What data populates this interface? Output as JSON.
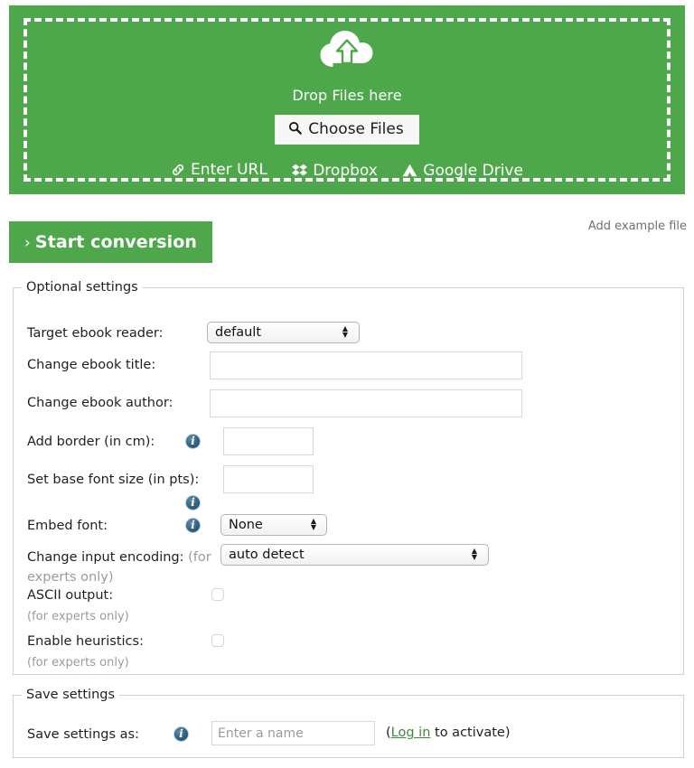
{
  "dropzone": {
    "icon": "cloud-upload-icon",
    "drop_label": "Drop Files here",
    "choose_files_label": "Choose Files",
    "choose_files_icon": "search-icon",
    "sources": [
      {
        "label": "Enter URL",
        "icon": "link-icon"
      },
      {
        "label": "Dropbox",
        "icon": "dropbox-icon"
      },
      {
        "label": "Google Drive",
        "icon": "google-drive-icon"
      }
    ],
    "bg_color": "#4ea74b",
    "border_color": "#ffffff"
  },
  "actions": {
    "start_conversion_label": "Start conversion",
    "start_conversion_chevron": "›",
    "add_example_file_label": "Add example file"
  },
  "optional_settings": {
    "legend": "Optional settings",
    "rows": {
      "target_reader": {
        "label": "Target ebook reader:",
        "value": "default",
        "options": [
          "default"
        ]
      },
      "ebook_title": {
        "label": "Change ebook title:",
        "value": "",
        "placeholder": ""
      },
      "ebook_author": {
        "label": "Change ebook author:",
        "value": "",
        "placeholder": ""
      },
      "border": {
        "label": "Add border (in cm):",
        "value": "",
        "placeholder": "",
        "info_icon": "info-icon"
      },
      "base_font_size": {
        "label": "Set base font size (in pts):",
        "value": "",
        "placeholder": "",
        "info_icon": "info-icon"
      },
      "embed_font": {
        "label": "Embed font:",
        "value": "None",
        "options": [
          "None"
        ],
        "info_icon": "info-icon"
      },
      "input_encoding": {
        "label": "Change input encoding:",
        "label_muted": "(for experts only)",
        "value": "auto detect",
        "options": [
          "auto detect"
        ]
      },
      "ascii_output": {
        "label": "ASCII output:",
        "sub": "(for experts only)",
        "checked": false
      },
      "enable_heuristics": {
        "label": "Enable heuristics:",
        "sub": "(for experts only)",
        "checked": false
      }
    }
  },
  "save_settings": {
    "legend": "Save settings",
    "label": "Save settings as:",
    "info_icon": "info-icon",
    "placeholder": "Enter a name",
    "value": "",
    "note_prefix": "(",
    "note_link": "Log in",
    "note_suffix": " to activate)"
  },
  "colors": {
    "brand_green": "#4ea74b",
    "link_green": "#3c8a3c",
    "info_blue": "#2f6182",
    "muted_gray": "#9b9b9b"
  }
}
